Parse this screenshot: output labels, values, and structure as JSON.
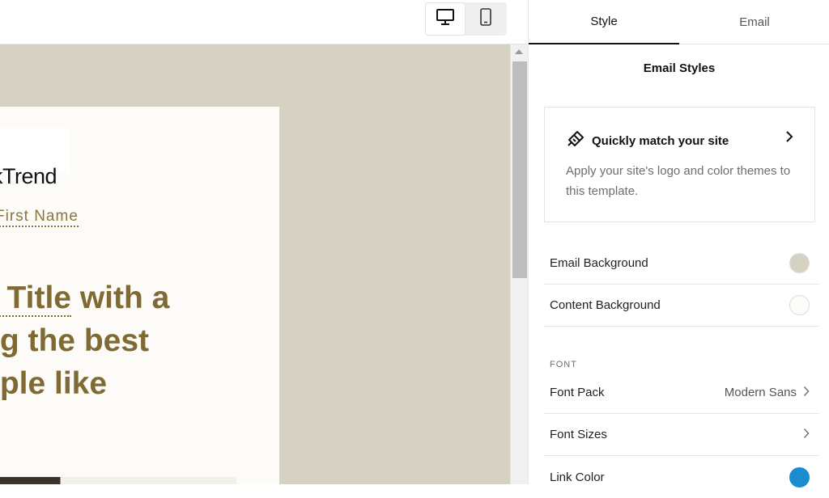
{
  "device_toggle": {
    "options": [
      {
        "name": "desktop",
        "icon": "desktop-icon",
        "active": true
      },
      {
        "name": "mobile",
        "icon": "mobile-icon",
        "active": false
      }
    ]
  },
  "preview": {
    "logo_text": "kTrend",
    "greeting": "First Name",
    "headline_line1_underlined": "e Title",
    "headline_line1_rest": " with a",
    "headline_line2": "ng the best",
    "headline_line3": "ople like",
    "colors": {
      "email_background": "#d5d2c4",
      "content_background": "#fcfbf7",
      "accent": "#7f6a33"
    }
  },
  "panel": {
    "tabs": [
      {
        "label": "Style",
        "active": true
      },
      {
        "label": "Email",
        "active": false
      }
    ],
    "title": "Email Styles",
    "match_card": {
      "icon": "paint-brush-icon",
      "title": "Quickly match your site",
      "description": "Apply your site's logo and color themes to this template."
    },
    "colors": [
      {
        "label": "Email Background",
        "swatch": "#d5d2c4"
      },
      {
        "label": "Content Background",
        "swatch": "#fcfbf7"
      }
    ],
    "font_section_label": "FONT",
    "font_rows": [
      {
        "label": "Font Pack",
        "value": "Modern Sans"
      },
      {
        "label": "Font Sizes",
        "value": ""
      }
    ],
    "link_color": {
      "label": "Link Color",
      "swatch": "#1a8ccf"
    }
  }
}
